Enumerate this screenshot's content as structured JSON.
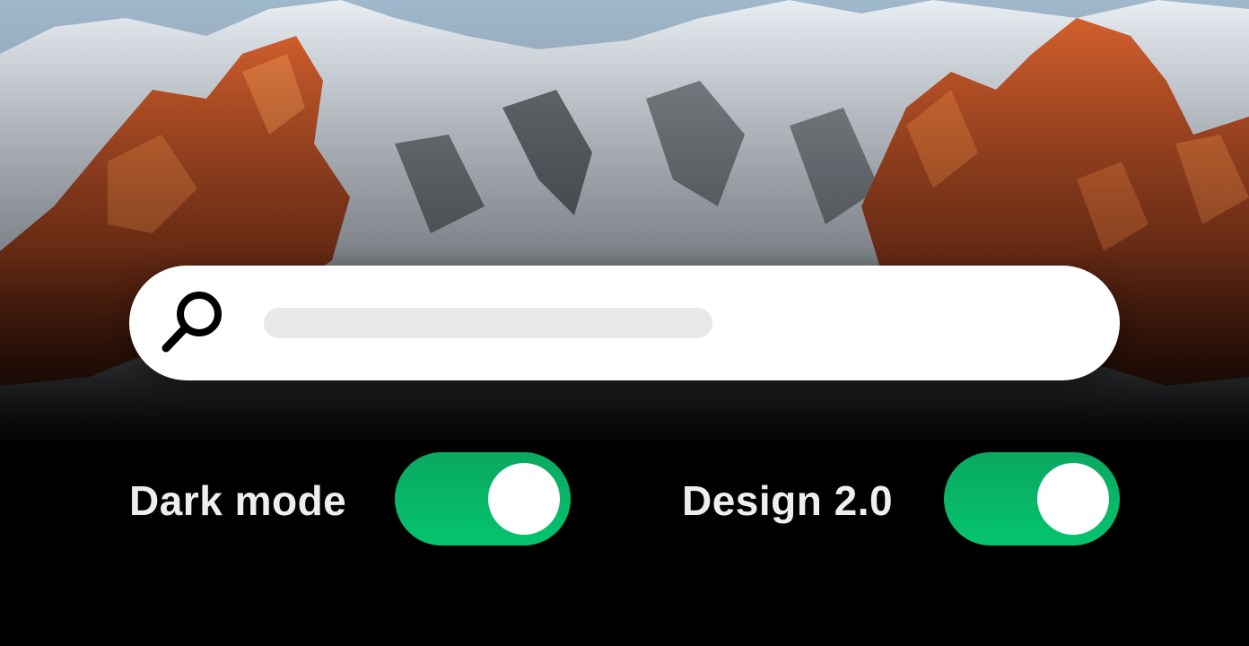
{
  "search": {
    "placeholder": "",
    "icon": "search-icon"
  },
  "toggles": [
    {
      "label": "Dark mode",
      "state": "on",
      "color": "#05c46d"
    },
    {
      "label": "Design 2.0",
      "state": "on",
      "color": "#05c46d"
    }
  ],
  "colors": {
    "toggle_on": "#05c46d",
    "search_bg": "#ffffff",
    "label_text": "#eeeeee",
    "background": "#000000"
  }
}
